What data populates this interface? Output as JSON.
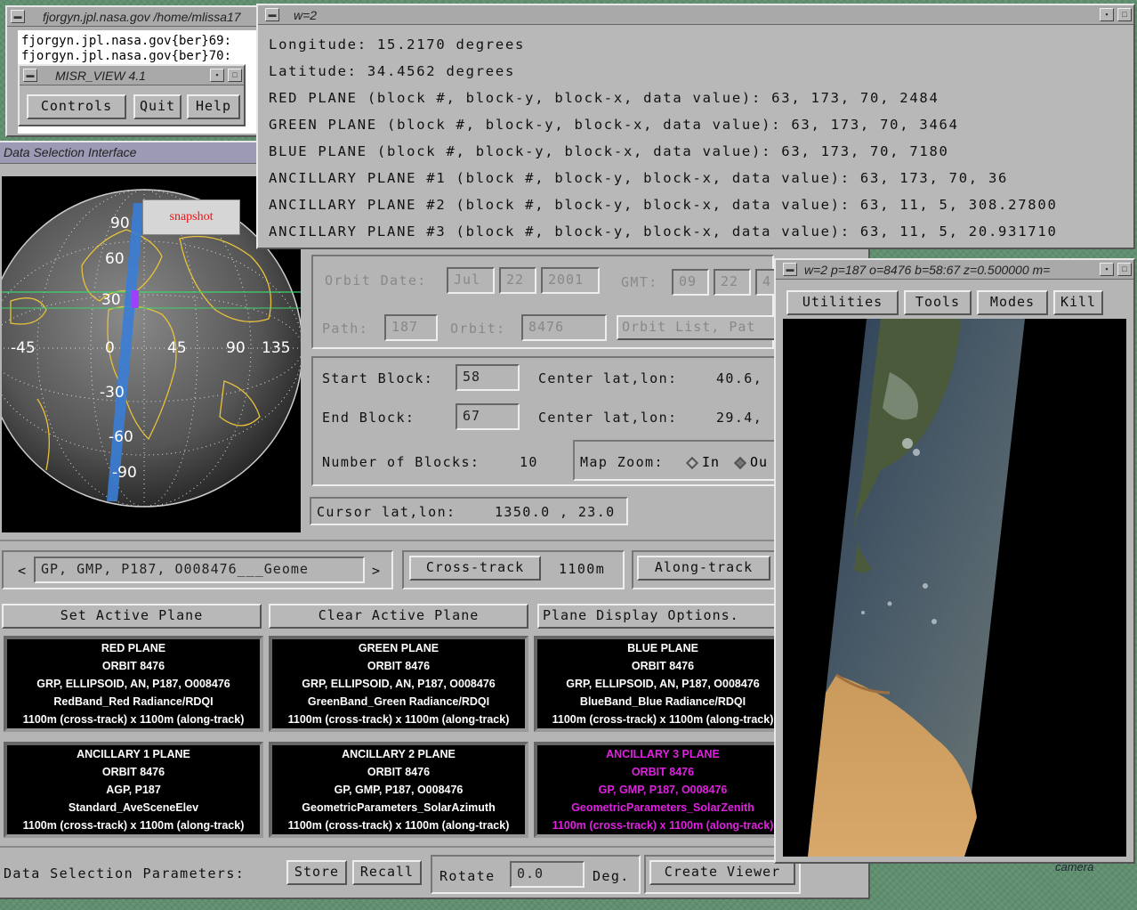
{
  "terminal": {
    "title": "fjorgyn.jpl.nasa.gov /home/mlissa17",
    "lines": [
      "fjorgyn.jpl.nasa.gov{ber}69:",
      "fjorgyn.jpl.nasa.gov{ber}70:"
    ]
  },
  "misr_view": {
    "title": "MISR_VIEW 4.1",
    "buttons": [
      "Controls",
      "Quit",
      "Help"
    ]
  },
  "data_selection": {
    "title": "Data Selection Interface",
    "snapshot_label": "snapshot",
    "globe_labels": [
      "90",
      "60",
      "30",
      "-45",
      "0",
      "45",
      "90",
      "135",
      "-30",
      "-60",
      "-90"
    ],
    "orbit_date_label": "Orbit Date:",
    "orbit_date": [
      "Jul",
      "22",
      "2001"
    ],
    "gmt_label": "GMT:",
    "gmt": [
      "09",
      "22",
      "4"
    ],
    "path_label": "Path:",
    "path_value": "187",
    "orbit_label": "Orbit:",
    "orbit_value": "8476",
    "orbit_list_button": "Orbit List, Pat",
    "start_block_label": "Start Block:",
    "start_block": "58",
    "end_block_label": "End Block:",
    "end_block": "67",
    "center_label": "Center lat,lon:",
    "center_start": "40.6,",
    "center_end": "29.4,",
    "num_blocks_label": "Number of Blocks:",
    "num_blocks": "10",
    "map_zoom_label": "Map Zoom:",
    "map_zoom_in": "In",
    "map_zoom_out": "Ou",
    "cursor_label": "Cursor lat,lon:",
    "cursor_value": "1350.0 , 23.0",
    "product_prev": "<",
    "product_value": "GP, GMP, P187, O008476___Geome",
    "product_next": ">",
    "cross_track_button": "Cross-track",
    "cross_track_value": "1100m",
    "along_track_button": "Along-track",
    "set_active_plane": "Set Active Plane",
    "clear_active_plane": "Clear Active Plane",
    "plane_display_options": "Plane Display Options.",
    "planes": [
      {
        "lines": [
          "RED PLANE",
          "ORBIT 8476",
          "GRP, ELLIPSOID, AN, P187, O008476",
          "RedBand_Red Radiance/RDQI",
          "1100m (cross-track) x 1100m (along-track)"
        ]
      },
      {
        "lines": [
          "GREEN PLANE",
          "ORBIT 8476",
          "GRP, ELLIPSOID, AN, P187, O008476",
          "GreenBand_Green Radiance/RDQI",
          "1100m (cross-track) x 1100m (along-track)"
        ]
      },
      {
        "lines": [
          "BLUE PLANE",
          "ORBIT 8476",
          "GRP, ELLIPSOID, AN, P187, O008476",
          "BlueBand_Blue Radiance/RDQI",
          "1100m (cross-track) x 1100m (along-track)"
        ]
      },
      {
        "lines": [
          "ANCILLARY 1 PLANE",
          "ORBIT 8476",
          "AGP, P187",
          "Standard_AveSceneElev",
          "1100m (cross-track) x 1100m (along-track)"
        ]
      },
      {
        "lines": [
          "ANCILLARY 2 PLANE",
          "ORBIT 8476",
          "GP, GMP, P187, O008476",
          "GeometricParameters_SolarAzimuth",
          "1100m (cross-track) x 1100m (along-track)"
        ]
      },
      {
        "lines": [
          "ANCILLARY 3 PLANE",
          "ORBIT 8476",
          "GP, GMP, P187, O008476",
          "GeometricParameters_SolarZenith",
          "1100m (cross-track) x 1100m (along-track)"
        ]
      }
    ],
    "dsp_label": "Data Selection Parameters:",
    "store_button": "Store",
    "recall_button": "Recall",
    "rotate_label": "Rotate",
    "rotate_value": "0.0",
    "deg_label": "Deg.",
    "create_viewer_button": "Create Viewer"
  },
  "info_window": {
    "title": "w=2",
    "lines": [
      "Longitude: 15.2170 degrees",
      "Latitude: 34.4562 degrees",
      "RED PLANE (block #, block-y, block-x, data value): 63, 173, 70, 2484",
      "GREEN PLANE (block #, block-y, block-x, data value): 63, 173, 70, 3464",
      "BLUE PLANE (block #, block-y, block-x, data value): 63, 173, 70, 7180",
      "ANCILLARY PLANE #1 (block #, block-y, block-x, data value): 63, 173, 70, 36",
      "ANCILLARY PLANE #2 (block #, block-y, block-x, data value): 63, 11, 5, 308.27800",
      "ANCILLARY PLANE #3 (block #, block-y, block-x, data value): 63, 11, 5, 20.931710"
    ]
  },
  "viewer": {
    "title": "w=2  p=187  o=8476  b=58:67  z=0.500000  m=",
    "menu": [
      "Utilities",
      "Tools",
      "Modes",
      "Kill"
    ]
  },
  "desktop": {
    "camera_label": "camera"
  }
}
